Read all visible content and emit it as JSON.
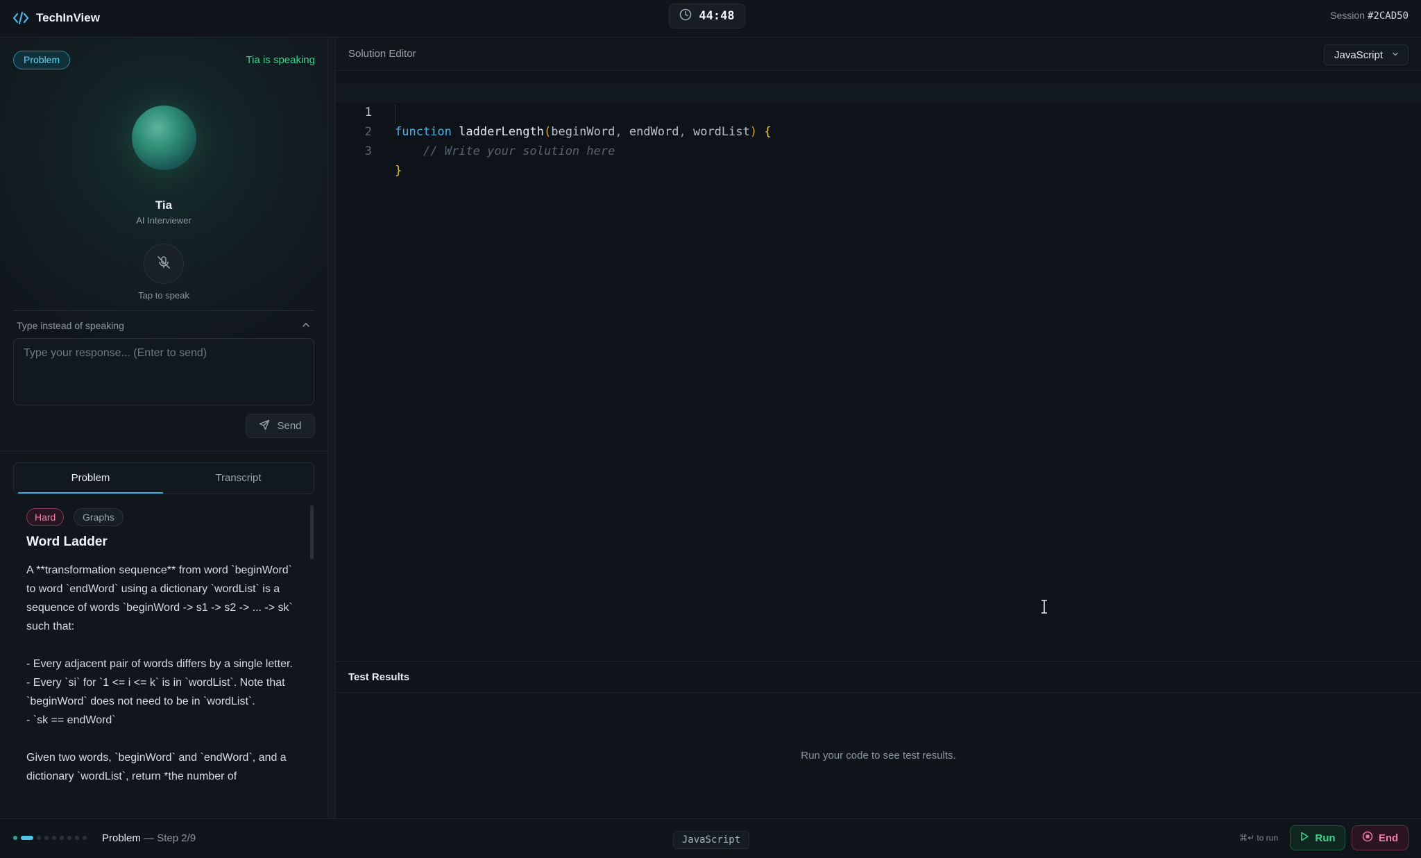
{
  "app": {
    "name": "TechInView"
  },
  "timer": {
    "value": "44:48"
  },
  "session": {
    "label": "Session",
    "id": "#2CAD50"
  },
  "interviewer": {
    "badge": "Problem",
    "status": "Tia is speaking",
    "name": "Tia",
    "role": "AI Interviewer",
    "mic_hint": "Tap to speak"
  },
  "text_input": {
    "label": "Type instead of speaking",
    "placeholder": "Type your response... (Enter to send)",
    "send_label": "Send"
  },
  "tabs": [
    {
      "label": "Problem",
      "active": true
    },
    {
      "label": "Transcript",
      "active": false
    }
  ],
  "problem": {
    "difficulty": "Hard",
    "topic": "Graphs",
    "title": "Word Ladder",
    "paragraphs": [
      "A **transformation sequence** from word `beginWord` to word `endWord` using a dictionary `wordList` is a sequence of words `beginWord -> s1 -> s2 -> ... -> sk` such that:",
      "- Every adjacent pair of words differs by a single letter.",
      "- Every `si` for `1 <= i <= k` is in `wordList`. Note that `beginWord` does not need to be in `wordList`.",
      "- `sk == endWord`",
      "Given two words, `beginWord` and `endWord`, and a dictionary `wordList`, return *the number of"
    ]
  },
  "editor": {
    "title": "Solution Editor",
    "language": "JavaScript",
    "lines": [
      {
        "number": "1",
        "keyword": "function",
        "name": "ladderLength",
        "params": [
          "beginWord",
          "endWord",
          "wordList"
        ]
      },
      {
        "number": "2",
        "comment": "// Write your solution here"
      },
      {
        "number": "3",
        "text": "}"
      }
    ]
  },
  "tests": {
    "title": "Test Results",
    "empty_message": "Run your code to see test results."
  },
  "footer": {
    "step_label": "Problem",
    "step_detail": "— Step 2/9",
    "language": "JavaScript",
    "shortcut": "⌘↵ to run",
    "run_label": "Run",
    "end_label": "End"
  },
  "colors": {
    "accent": "#3aa8d8",
    "success": "#3fd48c",
    "danger": "#f27ab2",
    "background": "#0f141b"
  }
}
